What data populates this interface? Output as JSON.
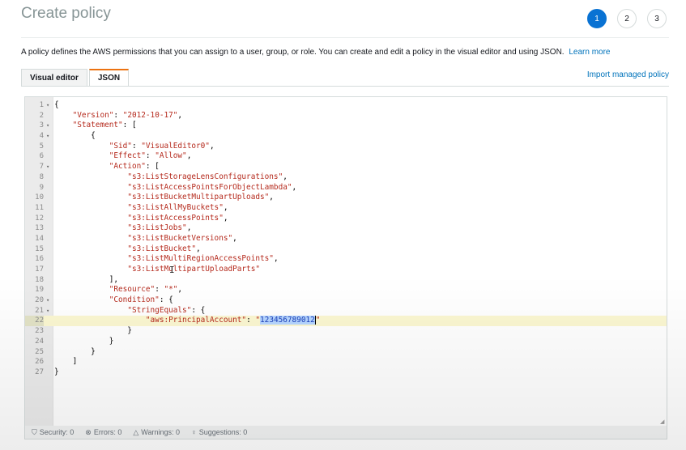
{
  "page": {
    "title": "Create policy",
    "steps": [
      "1",
      "2",
      "3"
    ],
    "active_step": 0,
    "description": "A policy defines the AWS permissions that you can assign to a user, group, or role. You can create and edit a policy in the visual editor and using JSON.",
    "learn_more": "Learn more"
  },
  "tabs": [
    {
      "label": "Visual editor",
      "active": false
    },
    {
      "label": "JSON",
      "active": true
    }
  ],
  "import_link": "Import managed policy",
  "colors": {
    "accent": "#0972d3",
    "tab_active_border": "#ec7211",
    "string": "#b52a1d",
    "active_line": "#fbf7d1",
    "selection": "#b5d5ff"
  },
  "editor": {
    "active_line": 22,
    "selection": "123456789012",
    "lines": [
      {
        "n": "1",
        "fold": true,
        "text": "{"
      },
      {
        "n": "2",
        "fold": false,
        "text": "    \"Version\": \"2012-10-17\","
      },
      {
        "n": "3",
        "fold": true,
        "text": "    \"Statement\": ["
      },
      {
        "n": "4",
        "fold": true,
        "text": "        {"
      },
      {
        "n": "5",
        "fold": false,
        "text": "            \"Sid\": \"VisualEditor0\","
      },
      {
        "n": "6",
        "fold": false,
        "text": "            \"Effect\": \"Allow\","
      },
      {
        "n": "7",
        "fold": true,
        "text": "            \"Action\": ["
      },
      {
        "n": "8",
        "fold": false,
        "text": "                \"s3:ListStorageLensConfigurations\","
      },
      {
        "n": "9",
        "fold": false,
        "text": "                \"s3:ListAccessPointsForObjectLambda\","
      },
      {
        "n": "10",
        "fold": false,
        "text": "                \"s3:ListBucketMultipartUploads\","
      },
      {
        "n": "11",
        "fold": false,
        "text": "                \"s3:ListAllMyBuckets\","
      },
      {
        "n": "12",
        "fold": false,
        "text": "                \"s3:ListAccessPoints\","
      },
      {
        "n": "13",
        "fold": false,
        "text": "                \"s3:ListJobs\","
      },
      {
        "n": "14",
        "fold": false,
        "text": "                \"s3:ListBucketVersions\","
      },
      {
        "n": "15",
        "fold": false,
        "text": "                \"s3:ListBucket\","
      },
      {
        "n": "16",
        "fold": false,
        "text": "                \"s3:ListMultiRegionAccessPoints\","
      },
      {
        "n": "17",
        "fold": false,
        "text": "                \"s3:ListMultipartUploadParts\""
      },
      {
        "n": "18",
        "fold": false,
        "text": "            ],"
      },
      {
        "n": "19",
        "fold": false,
        "text": "            \"Resource\": \"*\","
      },
      {
        "n": "20",
        "fold": true,
        "text": "            \"Condition\": {"
      },
      {
        "n": "21",
        "fold": true,
        "text": "                \"StringEquals\": {"
      },
      {
        "n": "22",
        "fold": false,
        "text": "                    \"aws:PrincipalAccount\": \"123456789012\""
      },
      {
        "n": "23",
        "fold": false,
        "text": "                }"
      },
      {
        "n": "24",
        "fold": false,
        "text": "            }"
      },
      {
        "n": "25",
        "fold": false,
        "text": "        }"
      },
      {
        "n": "26",
        "fold": false,
        "text": "    ]"
      },
      {
        "n": "27",
        "fold": false,
        "text": "}"
      }
    ]
  },
  "status_bar": [
    {
      "icon": "shield-icon",
      "glyph": "⛉",
      "label": "Security: 0"
    },
    {
      "icon": "error-icon",
      "glyph": "⊗",
      "label": "Errors: 0"
    },
    {
      "icon": "warning-icon",
      "glyph": "△",
      "label": "Warnings: 0"
    },
    {
      "icon": "lightbulb-icon",
      "glyph": "♀",
      "label": "Suggestions: 0"
    }
  ]
}
